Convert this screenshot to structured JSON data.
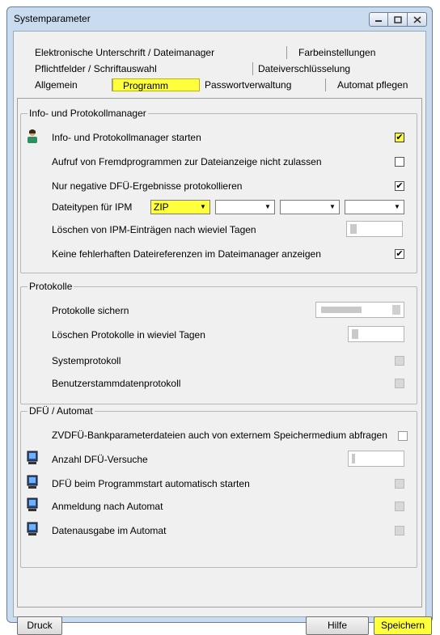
{
  "window": {
    "title": "Systemparameter",
    "icons": [
      "minimize-icon",
      "maximize-icon",
      "close-icon"
    ]
  },
  "tabs": {
    "row1": [
      "Elektronische Unterschrift / Dateimanager",
      "Farbeinstellungen"
    ],
    "row2": [
      "Pflichtfelder / Schriftauswahl",
      "Dateiverschlüsselung"
    ],
    "row3": [
      "Allgemein",
      "Programm",
      "Passwortverwaltung",
      "Automat pflegen"
    ],
    "selected": "Programm"
  },
  "info": {
    "label": "Info- und Protokollmanager",
    "start": "Info- und Protokollmanager starten",
    "fremd": "Aufruf von Fremdprogrammen zur Dateianzeige nicht zulassen",
    "negativ": "Nur negative DFÜ-Ergebnisse protokollieren",
    "dateitypen": "Dateitypen für IPM",
    "ipm_type": "ZIP",
    "loeschen": "Löschen von IPM-Einträgen nach wieviel Tagen",
    "fehlerhaft": "Keine fehlerhaften Dateireferenzen im Dateimanager anzeigen",
    "check_start": "✔",
    "check_negativ": "✔",
    "check_fehlerhaft": "✔"
  },
  "protokolle": {
    "label": "Protokolle",
    "sichern": "Protokolle sichern",
    "loeschen": "Löschen Protokolle in wieviel Tagen",
    "system": "Systemprotokoll",
    "benutzer": "Benutzerstammdatenprotokoll"
  },
  "dfue": {
    "label": "DFÜ / Automat",
    "zvdfue": "ZVDFÜ-Bankparameterdateien auch von externem Speichermedium abfragen",
    "versuche": "Anzahl DFÜ-Versuche",
    "autostart": "DFÜ beim Programmstart automatisch starten",
    "anmeldung": "Anmeldung nach Automat",
    "datenausgabe": "Datenausgabe im Automat"
  },
  "buttons": {
    "druck": "Druck",
    "hilfe": "Hilfe",
    "speichern": "Speichern"
  }
}
